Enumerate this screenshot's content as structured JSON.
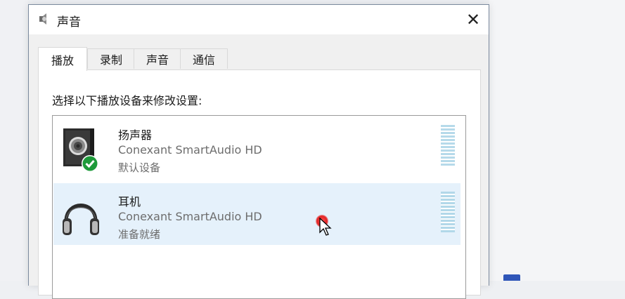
{
  "window": {
    "title": "声音",
    "title_icon": "speaker-icon",
    "close_icon": "close-icon",
    "close_label": "✕"
  },
  "tabs": [
    {
      "label": "播放",
      "active": true
    },
    {
      "label": "录制",
      "active": false
    },
    {
      "label": "声音",
      "active": false
    },
    {
      "label": "通信",
      "active": false
    }
  ],
  "panel": {
    "instruction": "选择以下播放设备来修改设置:"
  },
  "devices": [
    {
      "name": "扬声器",
      "driver": "Conexant SmartAudio HD",
      "status": "默认设备",
      "icon": "speaker-device-icon",
      "badge": "default-check-icon",
      "selected": false
    },
    {
      "name": "耳机",
      "driver": "Conexant SmartAudio HD",
      "status": "准备就绪",
      "icon": "headphones-icon",
      "selected": true
    }
  ],
  "colors": {
    "selection": "#e5f1fb",
    "meter": "#a9d3e6",
    "check_badge": "#1e9a3a",
    "cursor_highlight": "#e32222"
  }
}
